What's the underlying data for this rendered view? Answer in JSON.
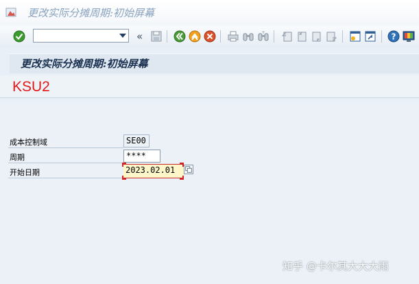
{
  "window": {
    "title": "更改实际分摊周期:初始屏幕"
  },
  "toolbar": {
    "command_field_value": "",
    "nav_chevron": "«"
  },
  "screen": {
    "header_title": "更改实际分摊周期:初始屏幕",
    "tcode": "KSU2"
  },
  "form": {
    "controlling_area": {
      "label": "成本控制域",
      "value": "SE00"
    },
    "cycle": {
      "label": "周期",
      "value": "****"
    },
    "start_date": {
      "label": "开始日期",
      "value": "2023.02.01"
    }
  },
  "watermark": "知乎 @卡尔其大大大雨",
  "colors": {
    "tcode": "#e01818",
    "required_border": "#c42a2a",
    "required_bg": "#fdf6c8",
    "background": "#ebf1f7"
  },
  "icons": [
    "sap-window-icon",
    "enter-check-icon",
    "command-dropdown-icon",
    "save-icon",
    "back-icon",
    "exit-icon",
    "cancel-icon",
    "print-icon",
    "find-icon",
    "find-next-icon",
    "first-page-icon",
    "previous-page-icon",
    "next-page-icon",
    "last-page-icon",
    "create-session-icon",
    "shortcut-icon",
    "help-icon",
    "layout-menu-icon",
    "value-help-icon"
  ]
}
